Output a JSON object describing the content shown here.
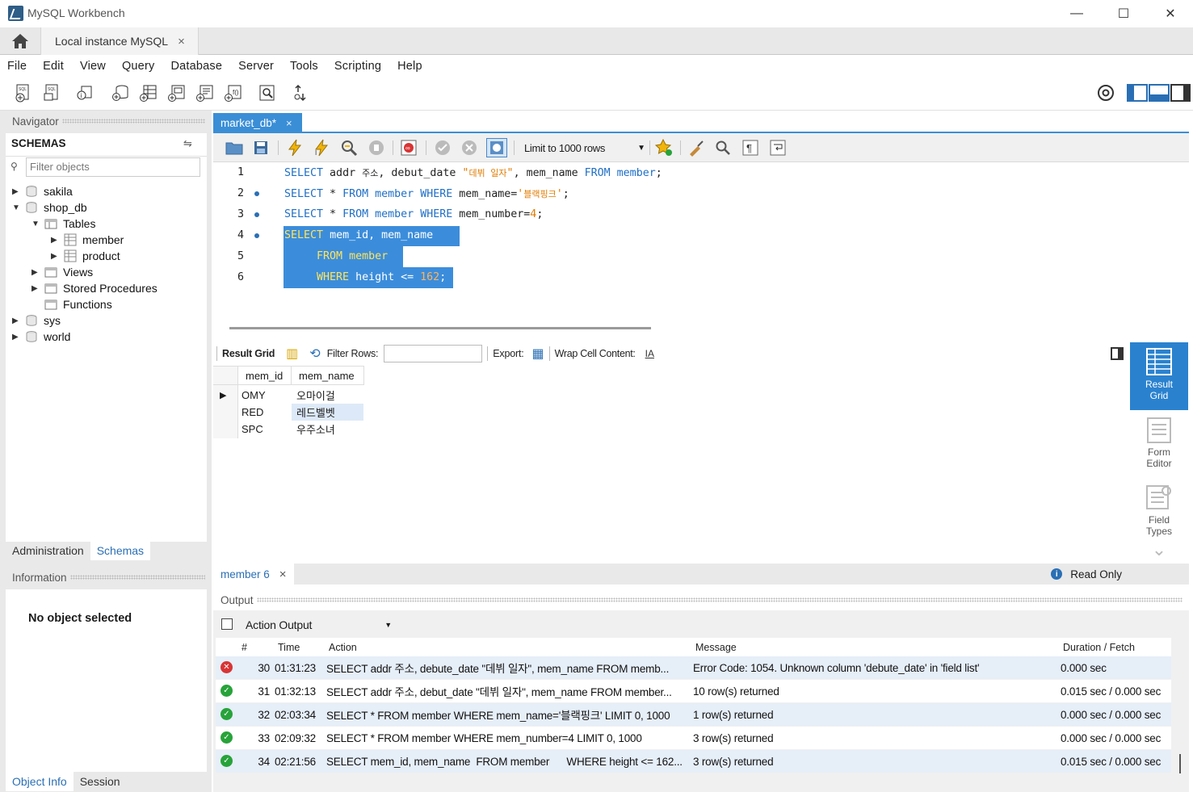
{
  "window": {
    "title": "MySQL Workbench",
    "minimize": "—",
    "maximize": "☐",
    "close": "✕"
  },
  "connection_tab": {
    "label": "Local instance MySQL",
    "close": "×"
  },
  "menu": [
    "File",
    "Edit",
    "View",
    "Query",
    "Database",
    "Server",
    "Tools",
    "Scripting",
    "Help"
  ],
  "navigator": {
    "header": "Navigator",
    "schemas_label": "SCHEMAS",
    "filter_placeholder": "Filter objects",
    "tree": {
      "sakila": "sakila",
      "shop_db": "shop_db",
      "tables": "Tables",
      "member": "member",
      "product": "product",
      "views": "Views",
      "stored_procedures": "Stored Procedures",
      "functions": "Functions",
      "sys": "sys",
      "world": "world"
    },
    "tabs": {
      "administration": "Administration",
      "schemas": "Schemas"
    }
  },
  "information": {
    "header": "Information",
    "empty_text": "No object selected",
    "tabs": {
      "object_info": "Object Info",
      "session": "Session"
    }
  },
  "editor": {
    "tab_label": "market_db*",
    "tab_close": "×",
    "limit_label": "Limit to 1000 rows",
    "lines": {
      "n1": "1",
      "n2": "2",
      "n3": "3",
      "n4": "4",
      "n5": "5",
      "n6": "6"
    }
  },
  "result": {
    "toolbar": {
      "result_grid": "Result Grid",
      "filter_rows": "Filter Rows:",
      "export": "Export:",
      "wrap": "Wrap Cell Content:"
    },
    "columns": [
      "mem_id",
      "mem_name"
    ],
    "rows": [
      [
        "OMY",
        "오마이걸"
      ],
      [
        "RED",
        "레드벨벳"
      ],
      [
        "SPC",
        "우주소녀"
      ]
    ],
    "side": {
      "result_grid": "Result Grid",
      "form_editor": "Form Editor",
      "field_types": "Field Types"
    },
    "footer_tab": "member 6",
    "footer_close": "×",
    "read_only": "Read Only"
  },
  "output": {
    "header": "Output",
    "selector": "Action Output",
    "columns": {
      "num": "#",
      "time": "Time",
      "action": "Action",
      "message": "Message",
      "duration": "Duration / Fetch"
    },
    "rows": [
      {
        "status": "error",
        "num": "30",
        "time": "01:31:23",
        "action": "SELECT addr 주소, debute_date \"데뷔 일자\", mem_name FROM memb...",
        "message": "Error Code: 1054. Unknown column 'debute_date' in 'field list'",
        "duration": "0.000 sec"
      },
      {
        "status": "ok",
        "num": "31",
        "time": "01:32:13",
        "action": "SELECT addr 주소, debut_date \"데뷔 일자\", mem_name FROM member...",
        "message": "10 row(s) returned",
        "duration": "0.015 sec / 0.000 sec"
      },
      {
        "status": "ok",
        "num": "32",
        "time": "02:03:34",
        "action": "SELECT * FROM member WHERE mem_name='블랙핑크' LIMIT 0, 1000",
        "message": "1 row(s) returned",
        "duration": "0.000 sec / 0.000 sec"
      },
      {
        "status": "ok",
        "num": "33",
        "time": "02:09:32",
        "action": "SELECT * FROM member WHERE mem_number=4 LIMIT 0, 1000",
        "message": "3 row(s) returned",
        "duration": "0.000 sec / 0.000 sec"
      },
      {
        "status": "ok",
        "num": "34",
        "time": "02:21:56",
        "action": "SELECT mem_id, mem_name  FROM member      WHERE height <= 162...",
        "message": "3 row(s) returned",
        "duration": "0.015 sec / 0.000 sec"
      }
    ]
  },
  "colors": {
    "accent": "#3a8ed6",
    "selection": "#3b8ddb",
    "keyword": "#1f6fc6",
    "string": "#e07b00",
    "ok": "#27a33a",
    "error": "#d83434"
  }
}
